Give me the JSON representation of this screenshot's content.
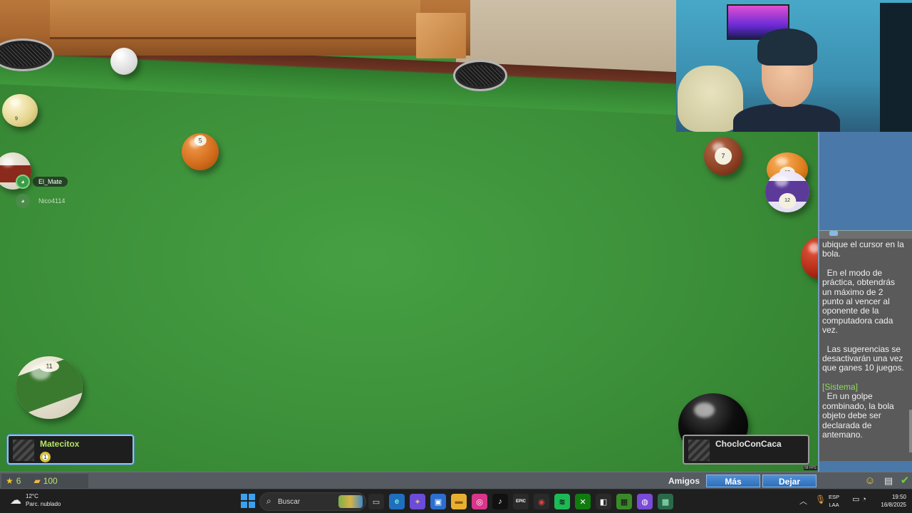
{
  "discord_overlay": {
    "users": [
      {
        "name": "El_Mate",
        "active": true
      },
      {
        "name": "Nico4114",
        "active": false
      }
    ]
  },
  "balls": {
    "ball_9": "9",
    "ball_5": "5",
    "ball_7": "7",
    "ball_13": "13",
    "ball_12": "12",
    "ball_11": "11"
  },
  "players": {
    "left": {
      "name": "Matecitox",
      "ball_number": "1"
    },
    "right": {
      "name": "ChocloConCaca"
    }
  },
  "fps_label": "58 FPS",
  "chat": {
    "messages": [
      "ubique el cursor en la bola.",
      "  En el modo de práctica, obtendrás un máximo de 2 punto al vencer al oponente de la computadora cada vez.",
      "  Las sugerencias se desactivarán una vez que ganes 10 juegos."
    ],
    "system_label": "[Sistema]",
    "system_message": "  En un golpe combinado, la bola objeto debe ser declarada de antemano."
  },
  "bottom_bar": {
    "stars": "6",
    "coins": "100",
    "amigos": "Amigos",
    "mas": "Más",
    "dejar": "Dejar"
  },
  "taskbar": {
    "weather_temp": "12°C",
    "weather_desc": "Parc. nublado",
    "search_placeholder": "Buscar",
    "apps": [
      {
        "name": "task-view",
        "glyph": "▭",
        "bg": "#2a2a2a",
        "color": "#d8d8d8"
      },
      {
        "name": "edge",
        "glyph": "e",
        "bg": "#1f6fbf",
        "color": "#7ff0c0"
      },
      {
        "name": "copilot",
        "glyph": "✦",
        "bg": "#6a4cd8",
        "color": "#f0c050"
      },
      {
        "name": "store",
        "glyph": "▣",
        "bg": "#2c6fcf",
        "color": "#ffffff"
      },
      {
        "name": "explorer",
        "glyph": "▬",
        "bg": "#e8b030",
        "color": "#8a5a10"
      },
      {
        "name": "instagram",
        "glyph": "◎",
        "bg": "#d8368a",
        "color": "#ffffff"
      },
      {
        "name": "tiktok",
        "glyph": "♪",
        "bg": "#111111",
        "color": "#ffffff"
      },
      {
        "name": "epic",
        "glyph": "EPIC",
        "bg": "#2a2a2a",
        "color": "#ffffff"
      },
      {
        "name": "steam-like",
        "glyph": "◉",
        "bg": "#2a2a2a",
        "color": "#e04040"
      },
      {
        "name": "spotify",
        "glyph": "≋",
        "bg": "#1db954",
        "color": "#111111"
      },
      {
        "name": "xbox",
        "glyph": "✕",
        "bg": "#107c10",
        "color": "#ffffff"
      },
      {
        "name": "capcut",
        "glyph": "◧",
        "bg": "#2a2a2a",
        "color": "#ffffff"
      },
      {
        "name": "minecraft",
        "glyph": "▦",
        "bg": "#3a8a2a",
        "color": "#111111"
      },
      {
        "name": "twitch-like",
        "glyph": "◍",
        "bg": "#7a4ad8",
        "color": "#ffffff"
      },
      {
        "name": "pool-game",
        "glyph": "▩",
        "bg": "#2a6a4a",
        "color": "#9af0c0"
      }
    ],
    "lang_top": "ESP",
    "lang_bottom": "LAA",
    "time": "19:50",
    "date": "16/8/2025"
  },
  "colors": {
    "felt": "#3d8f3a",
    "accent_blue": "#2f6fb8",
    "player_highlight": "#b6e46a",
    "system_green": "#8fdc5a"
  }
}
